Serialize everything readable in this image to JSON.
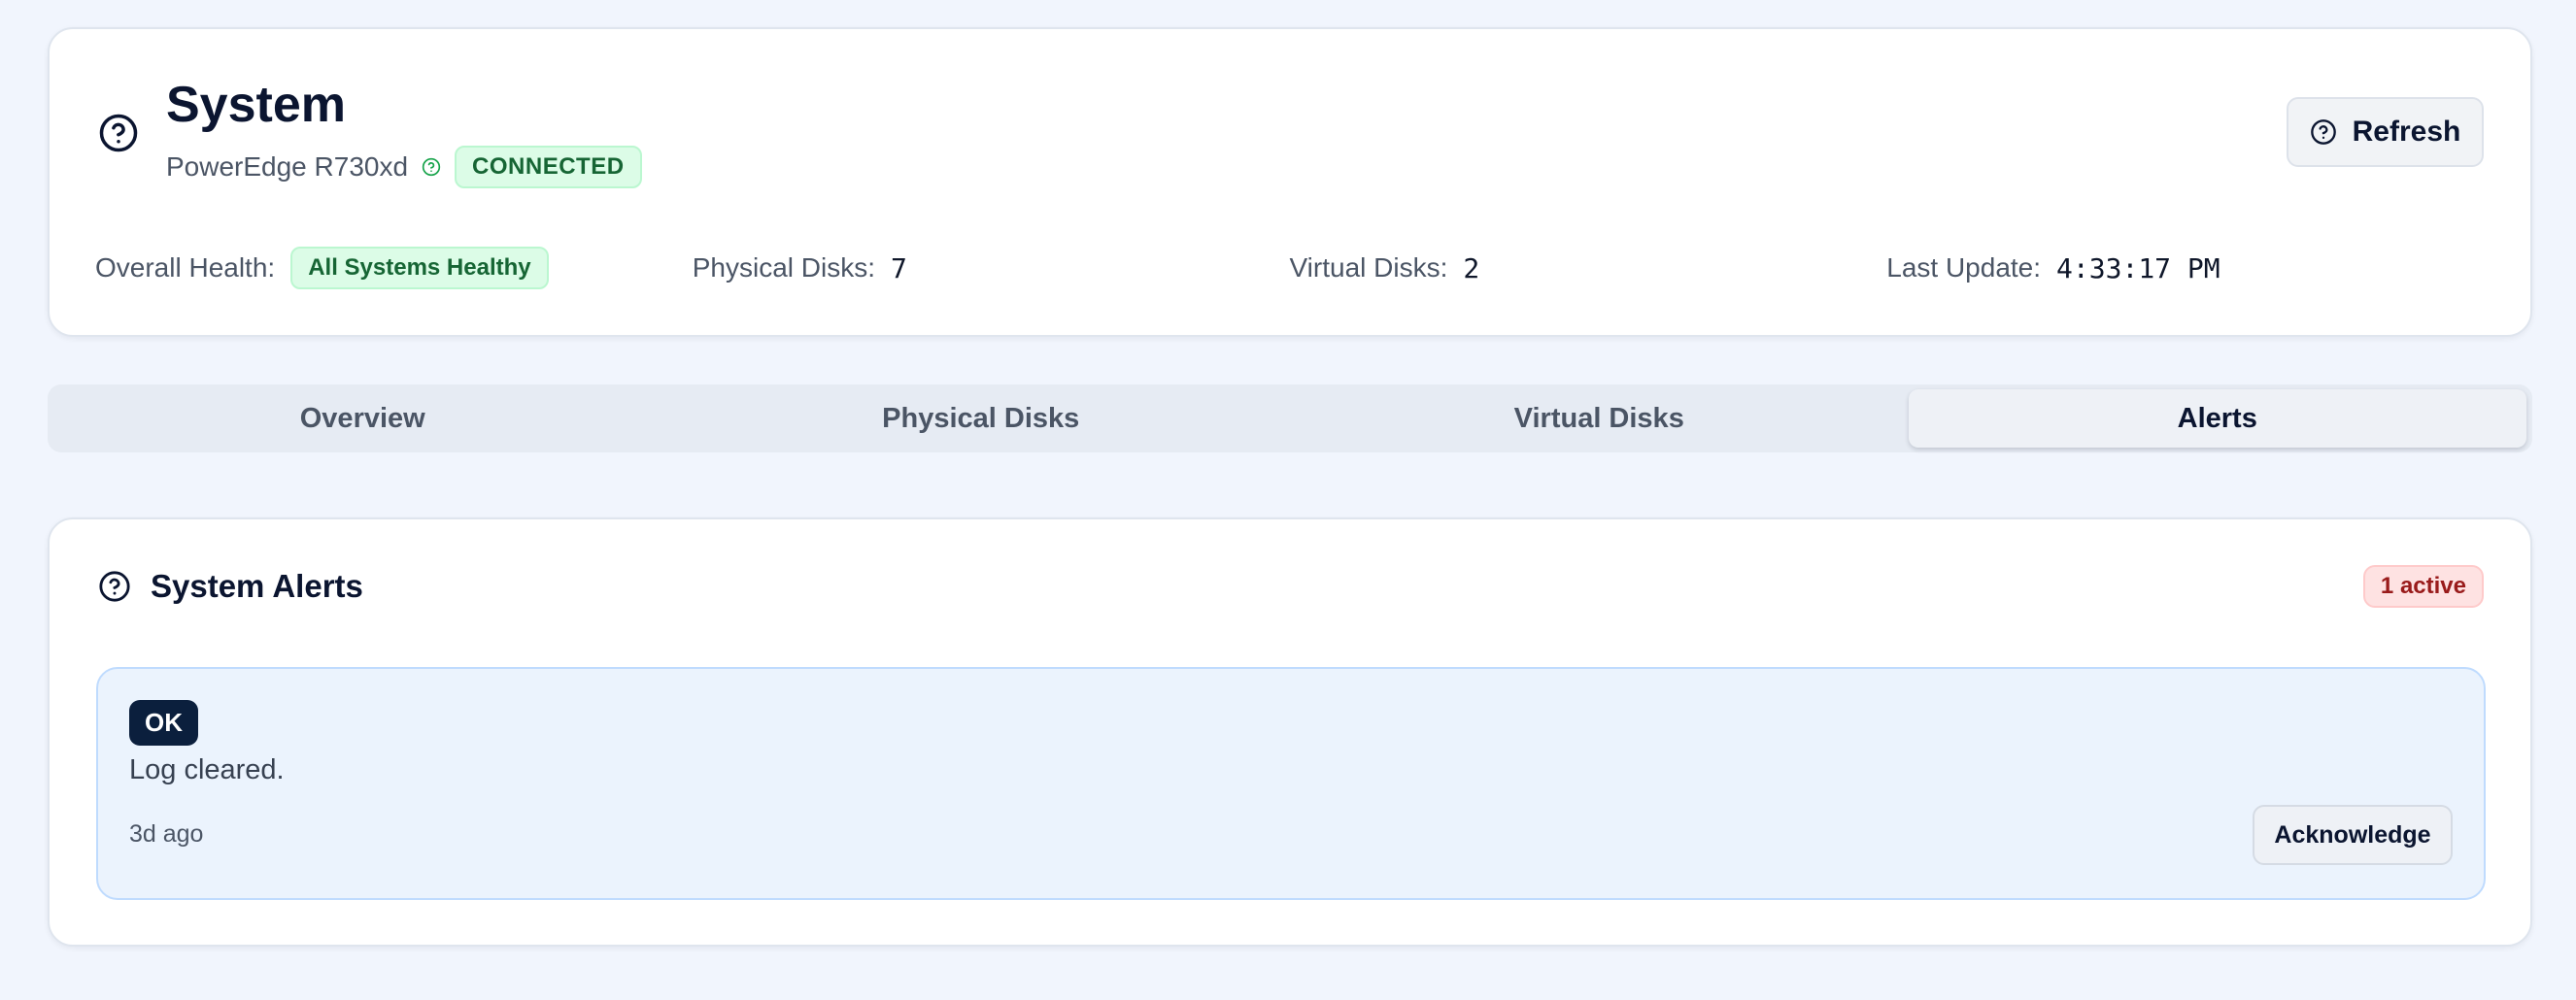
{
  "header": {
    "title": "System",
    "model": "PowerEdge R730xd",
    "connection_status": "CONNECTED",
    "refresh_label": "Refresh",
    "icons": {
      "system": "help-circle-icon",
      "status": "help-circle-icon",
      "refresh": "help-circle-icon"
    }
  },
  "stats": {
    "overall_health_label": "Overall Health:",
    "overall_health_value": "All Systems Healthy",
    "physical_disks_label": "Physical Disks:",
    "physical_disks_value": "7",
    "virtual_disks_label": "Virtual Disks:",
    "virtual_disks_value": "2",
    "last_update_label": "Last Update:",
    "last_update_value": "4:33:17 PM"
  },
  "tabs": [
    {
      "label": "Overview",
      "active": false
    },
    {
      "label": "Physical Disks",
      "active": false
    },
    {
      "label": "Virtual Disks",
      "active": false
    },
    {
      "label": "Alerts",
      "active": true
    }
  ],
  "alerts": {
    "title": "System Alerts",
    "active_count": "1 active",
    "items": [
      {
        "level": "OK",
        "message": "Log cleared.",
        "time": "3d ago",
        "action_label": "Acknowledge"
      }
    ]
  },
  "colors": {
    "background": "#f1f5fd",
    "healthy_green": "#166534",
    "alert_red": "#991b1b",
    "ok_badge": "#0b1f3d",
    "alert_bg": "#ebf3fd"
  }
}
